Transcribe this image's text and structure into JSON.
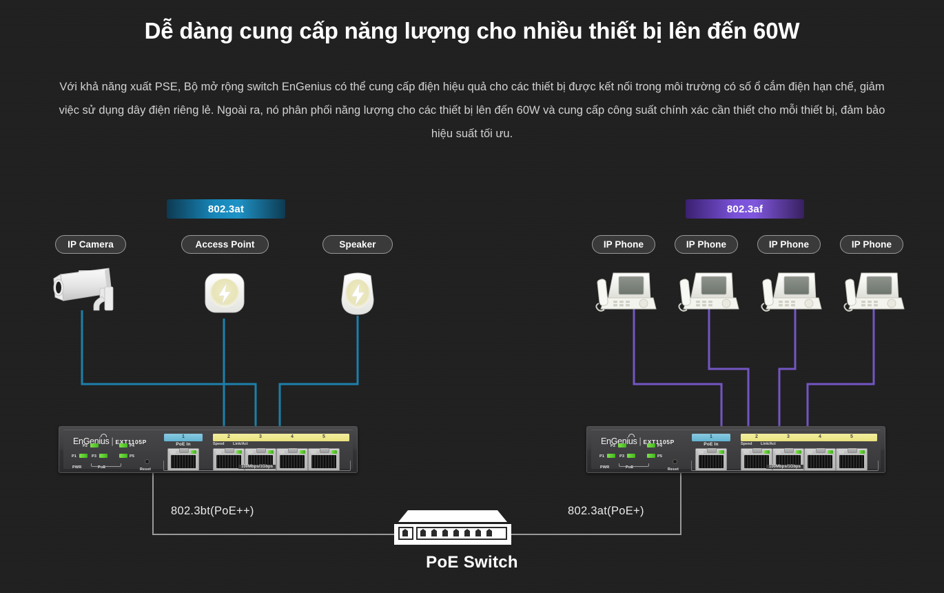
{
  "header": {
    "title": "Dễ dàng cung cấp năng lượng cho nhiều thiết bị lên đến 60W",
    "body": "Với khả năng xuất PSE, Bộ mở rộng switch EnGenius có thể cung cấp điện hiệu quả cho các thiết bị được kết nối trong môi trường có số ổ cắm điện hạn chế, giảm việc sử dụng dây điện riêng lẻ. Ngoài ra, nó phân phối năng lượng cho các thiết bị lên đến 60W và cung cấp công suất chính xác cần thiết cho mỗi thiết bị, đảm bảo hiệu suất tối ưu."
  },
  "standards": {
    "left_badge": "802.3at",
    "right_badge": "802.3af",
    "left_badge_color": "#1f93c6",
    "right_badge_color": "#7f57dd"
  },
  "left_group": {
    "devices": [
      {
        "label": "IP Camera",
        "icon": "ip-camera-icon"
      },
      {
        "label": "Access Point",
        "icon": "access-point-icon"
      },
      {
        "label": "Speaker",
        "icon": "speaker-icon"
      }
    ],
    "cable_color": "#1c80ab"
  },
  "right_group": {
    "devices": [
      {
        "label": "IP Phone",
        "icon": "ip-phone-icon"
      },
      {
        "label": "IP Phone",
        "icon": "ip-phone-icon"
      },
      {
        "label": "IP Phone",
        "icon": "ip-phone-icon"
      },
      {
        "label": "IP Phone",
        "icon": "ip-phone-icon"
      }
    ],
    "cable_color": "#7356c4"
  },
  "switch_device": {
    "brand": "EnGenius",
    "separator": "|",
    "model": "EXT1105P",
    "poe_in_label": "PoE In",
    "poe_in_port_number": "1",
    "port_numbers": [
      "2",
      "3",
      "4",
      "5"
    ],
    "speed_label": "Speed",
    "link_act_label": "Link/Act",
    "speed_range_label": "100Mbps/1Gbps",
    "reset_label": "Reset",
    "leds": [
      "P1",
      "P2",
      "P3",
      "P4",
      "P5"
    ],
    "power_label": "PWR",
    "poe_group_label": "PoE"
  },
  "uplinks": {
    "left_label": "802.3bt(PoE++)",
    "right_label": "802.3at(PoE+)",
    "switch_caption": "PoE Switch",
    "line_color": "#9a9a9a"
  }
}
